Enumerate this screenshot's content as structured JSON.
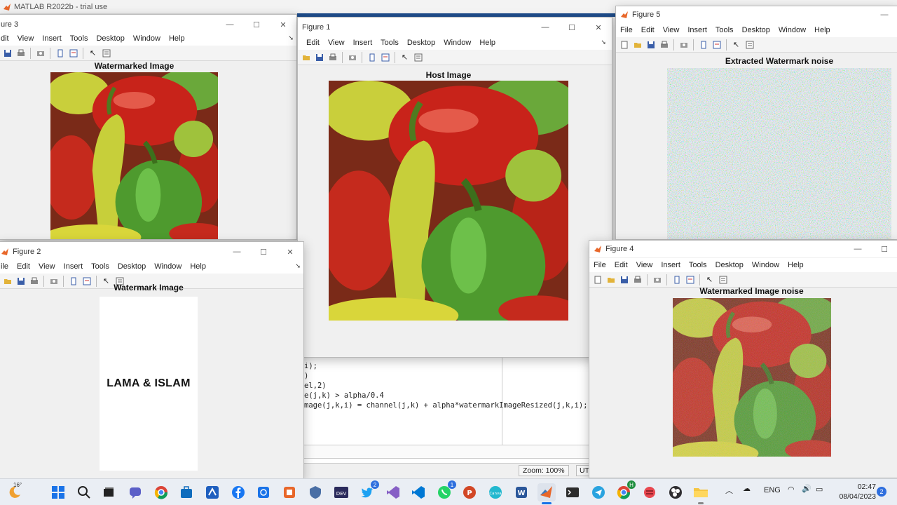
{
  "app": {
    "title": "MATLAB R2022b - trial use"
  },
  "code_lines": [
    "i);",
    ")",
    "el,2)",
    "e(j,k) > alpha/0.4",
    "mage(j,k,i) = channel(j,k) + alpha*watermarkImageResized(j,k,i);"
  ],
  "status": {
    "zoom": "Zoom: 100%",
    "encoding": "UTI"
  },
  "figure3": {
    "title": "ure 3",
    "menu": [
      "dit",
      "View",
      "Insert",
      "Tools",
      "Desktop",
      "Window",
      "Help"
    ],
    "plot_title": "Watermarked Image"
  },
  "figure1": {
    "title": "Figure 1",
    "menu": [
      "Edit",
      "View",
      "Insert",
      "Tools",
      "Desktop",
      "Window",
      "Help"
    ],
    "plot_title": "Host Image"
  },
  "figure5": {
    "title": "Figure 5",
    "menu": [
      "File",
      "Edit",
      "View",
      "Insert",
      "Tools",
      "Desktop",
      "Window",
      "Help"
    ],
    "plot_title": "Extracted Watermark noise"
  },
  "figure2": {
    "title": "Figure 2",
    "menu": [
      "ile",
      "Edit",
      "View",
      "Insert",
      "Tools",
      "Desktop",
      "Window",
      "Help"
    ],
    "plot_title": "Watermark Image",
    "watermark_text": "LAMA & ISLAM"
  },
  "figure4": {
    "title": "Figure 4",
    "menu": [
      "File",
      "Edit",
      "View",
      "Insert",
      "Tools",
      "Desktop",
      "Window",
      "Help"
    ],
    "plot_title": "Watermarked Image noise"
  },
  "taskbar": {
    "weather": "16°",
    "language": "ENG",
    "time": "02:47",
    "date": "08/04/2023",
    "notifications": "2",
    "twitter_badge": "2",
    "whatsapp_badge": "1",
    "chrome_badge": "H",
    "icons": [
      "start-icon",
      "search-icon",
      "task-view-icon",
      "chat-icon",
      "chrome-icon",
      "store-icon",
      "power-automate-icon",
      "facebook-icon",
      "snipping-icon",
      "office-icon",
      "shield-icon",
      "devhome-icon",
      "twitter-icon",
      "visual-studio-icon",
      "vscode-icon",
      "whatsapp-icon",
      "powerpoint-icon",
      "canva-icon",
      "word-icon",
      "matlab-icon",
      "terminal-icon",
      "telegram-icon",
      "chrome-profile-icon",
      "app-icon",
      "obs-icon",
      "file-explorer-icon"
    ]
  },
  "colors": {
    "pepper_red": "#c8231a",
    "pepper_green": "#4e9a2e",
    "pepper_yellow": "#c7cf3a",
    "matlab_blue": "#1f4e8c",
    "taskbar": "#eaeef4"
  }
}
